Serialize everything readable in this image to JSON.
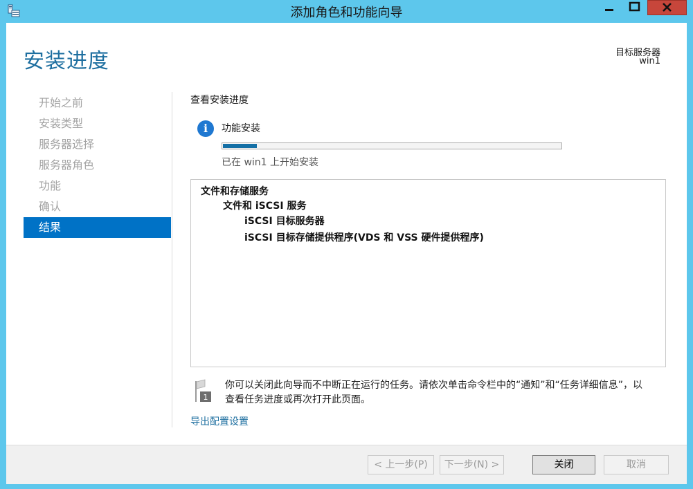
{
  "window": {
    "title": "添加角色和功能向导"
  },
  "header": {
    "page_title": "安装进度",
    "target_label": "目标服务器",
    "target_value": "win1"
  },
  "nav": {
    "items": [
      {
        "label": "开始之前",
        "active": false
      },
      {
        "label": "安装类型",
        "active": false
      },
      {
        "label": "服务器选择",
        "active": false
      },
      {
        "label": "服务器角色",
        "active": false
      },
      {
        "label": "功能",
        "active": false
      },
      {
        "label": "确认",
        "active": false
      },
      {
        "label": "结果",
        "active": true
      }
    ]
  },
  "main": {
    "section_title": "查看安装进度",
    "feature_label": "功能安装",
    "progress_fraction": 0.1,
    "status_text": "已在 win1 上开始安装",
    "results": [
      {
        "level": 0,
        "label": "文件和存储服务"
      },
      {
        "level": 1,
        "label": "文件和 iSCSI 服务"
      },
      {
        "level": 2,
        "label": "iSCSI 目标服务器"
      },
      {
        "level": 2,
        "label": "iSCSI 目标存储提供程序(VDS 和 VSS 硬件提供程序)"
      }
    ],
    "note_line1": "你可以关闭此向导而不中断正在运行的任务。请依次单击命令栏中的“通知”和“任务详细信息”，以",
    "note_line2": "查看任务进度或再次打开此页面。",
    "flag_badge": "1",
    "export_link": "导出配置设置"
  },
  "footer": {
    "prev_label": "< 上一步(P)",
    "next_label": "下一步(N) >",
    "close_label": "关闭",
    "cancel_label": "取消"
  },
  "colors": {
    "window_frame": "#5dc7ec",
    "accent": "#0072c6",
    "title_text": "#1e6fa0",
    "close_button": "#c7463b",
    "progress": "#1570a6"
  }
}
